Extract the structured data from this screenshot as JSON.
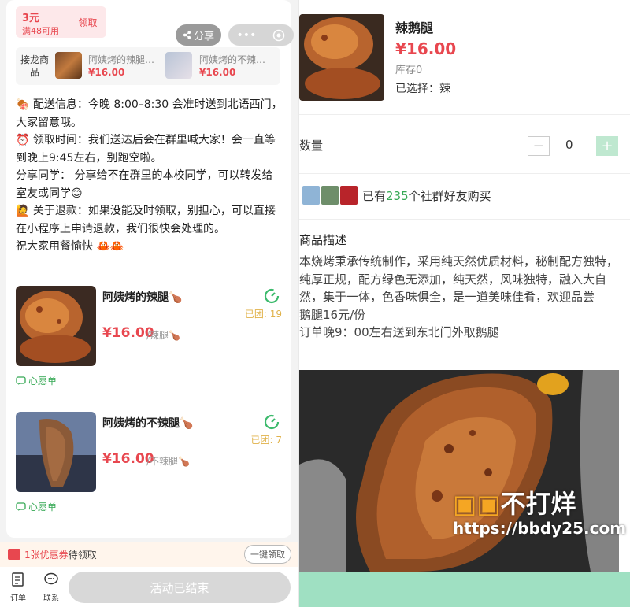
{
  "left": {
    "coupon": {
      "amount": "3元",
      "condition": "满48可用",
      "claim": "领取"
    },
    "share_label": "分享",
    "jielong": {
      "label": "接龙商品",
      "products": [
        {
          "name": "阿姨烤的辣腿…",
          "price": "¥16.00"
        },
        {
          "name": "阿姨烤的不辣…",
          "price": "¥16.00"
        }
      ]
    },
    "notice": [
      "🍖 配送信息：今晚 8:00–8:30 会准时送到北语西门，大家留意哦。",
      "⏰ 领取时间：我们送达后会在群里喊大家！会一直等到晚上9:45左右，别跑空啦。",
      "分享同学： 分享给不在群里的本校同学，可以转发给室友或同学😊",
      "🙋 关于退款：如果没能及时领取，别担心，可以直接在小程序上申请退款，我们很快会处理的。",
      "祝大家用餐愉快 🦀🦀"
    ],
    "items": [
      {
        "name": "阿姨烤的辣腿🍗",
        "price": "¥16.00",
        "unit": "/辣腿🍗",
        "team": "已团: 19",
        "wish": "心愿单"
      },
      {
        "name": "阿姨烤的不辣腿🍗",
        "price": "¥16.00",
        "unit": "/不辣腿🍗",
        "team": "已团: 7",
        "wish": "心愿单"
      }
    ],
    "coupon_bar": {
      "count": "1张优惠券",
      "suffix": "待领取",
      "button": "一键领取"
    },
    "bottom": {
      "orders": "订单",
      "contact": "联系",
      "ended": "活动已结束"
    }
  },
  "right": {
    "name": "辣鹅腿",
    "price": "¥16.00",
    "stock": "库存0",
    "selected": "已选择：辣",
    "qty_label": "数量",
    "qty_minus": "−",
    "qty_value": "0",
    "qty_plus": "+",
    "buyers_prefix": "已有",
    "buyers_count": "235",
    "buyers_suffix": "个社群好友购买",
    "desc_title": "商品描述",
    "desc_lines": [
      "本烧烤秉承传统制作，采用纯天然优质材料，秘制配方独特，纯厚正规，配方绿色无添加，纯天然，风味独特，融入大自然，集于一体，色香味俱全，是一道美味佳肴，欢迎品尝",
      "鹅腿16元/份",
      "订单晚9：00左右送到东北门外取鹅腿"
    ],
    "watermark": {
      "brand": "不打烊",
      "url": "https://bbdy25.com"
    }
  }
}
